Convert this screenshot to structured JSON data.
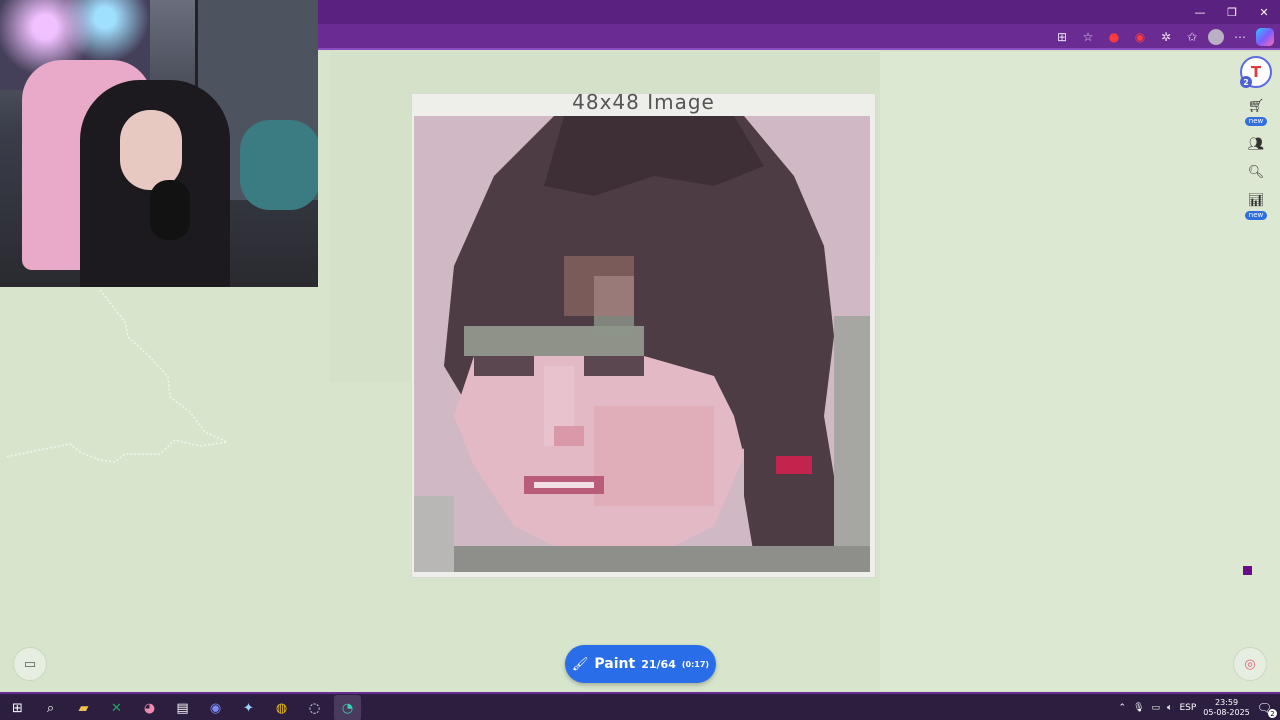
{
  "browser": {
    "window_controls": [
      "—",
      "❐",
      "✕"
    ],
    "toolbar_icons": [
      "app-icon",
      "star-icon",
      "extension-red-icon",
      "extension-record-icon",
      "puzzle-icon",
      "favorites-icon",
      "profile-avatar",
      "more-icon",
      "copilot-icon"
    ]
  },
  "template_card": {
    "title": "48x48 Image"
  },
  "sidebar": {
    "logo_badge": "2",
    "items": [
      {
        "icon": "store-icon",
        "badge": "new"
      },
      {
        "icon": "group-icon",
        "badge": ""
      },
      {
        "icon": "search-zoom-icon",
        "badge": ""
      },
      {
        "icon": "leaderboard-icon",
        "badge": "new"
      }
    ]
  },
  "paint_button": {
    "label": "Paint",
    "count": "21/64",
    "timer": "(0:17)"
  },
  "selected_color": "#6a0a8c",
  "taskbar": {
    "apps": [
      "windows-start",
      "search",
      "file-explorer",
      "excel",
      "app-pink",
      "app-terminal",
      "discord",
      "app-feather",
      "chrome",
      "app-obs",
      "edge"
    ],
    "tray": {
      "language": "ESP",
      "time": "23:59",
      "date": "05-08-2025",
      "notifications": "2"
    }
  }
}
